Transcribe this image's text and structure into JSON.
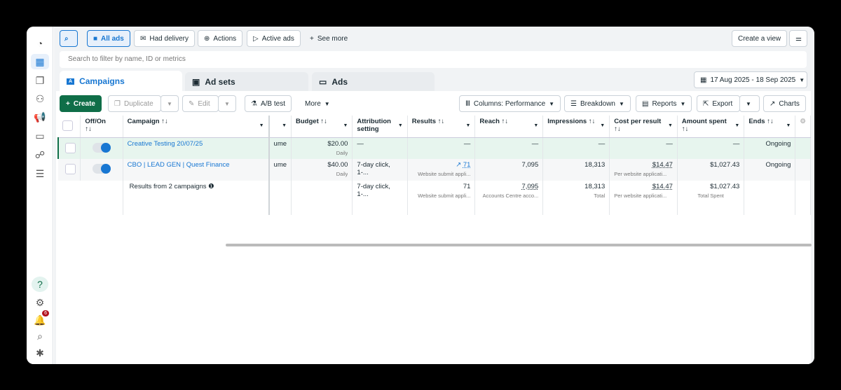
{
  "sidebar": {
    "notification_count": "6",
    "help": "?"
  },
  "filters": {
    "all_ads": "All ads",
    "had_delivery": "Had delivery",
    "actions": "Actions",
    "active_ads": "Active ads",
    "see_more": "See more",
    "create_view": "Create a view"
  },
  "search": {
    "placeholder": "Search to filter by name, ID or metrics"
  },
  "tabs": [
    {
      "label": "Campaigns"
    },
    {
      "label": "Ad sets"
    },
    {
      "label": "Ads"
    }
  ],
  "date_range": "17 Aug 2025 - 18 Sep 2025",
  "toolbar": {
    "create": "Create",
    "duplicate": "Duplicate",
    "edit": "Edit",
    "ab_test": "A/B test",
    "more": "More",
    "columns": "Columns: Performance",
    "breakdown": "Breakdown",
    "reports": "Reports",
    "export": "Export",
    "charts": "Charts"
  },
  "columns": {
    "offon": "Off/On",
    "sort": "↑↓",
    "campaign": "Campaign",
    "budget": "Budget",
    "attribution": "Attribution setting",
    "results": "Results",
    "reach": "Reach",
    "impressions": "Impressions",
    "cost": "Cost per result",
    "amount": "Amount spent",
    "ends": "Ends"
  },
  "rows": [
    {
      "name": "Creative Testing 20/07/25",
      "partial": "ume",
      "budget": "$20.00",
      "budget_type": "Daily",
      "attribution": "—",
      "results": "—",
      "reach": "—",
      "impressions": "—",
      "cost": "—",
      "amount": "—",
      "ends": "Ongoing"
    },
    {
      "name": "CBO | LEAD GEN | Quest Finance",
      "partial": "ume",
      "budget": "$40.00",
      "budget_type": "Daily",
      "attribution": "7-day click, 1-...",
      "results": "71",
      "results_sub": "Website submit appli...",
      "reach": "7,095",
      "impressions": "18,313",
      "cost": "$14.47",
      "cost_sub": "Per website applicati...",
      "amount": "$1,027.43",
      "ends": "Ongoing"
    }
  ],
  "summary": {
    "label": "Results from 2 campaigns",
    "attribution": "7-day click, 1-...",
    "results": "71",
    "results_sub": "Website submit appli...",
    "reach": "7,095",
    "reach_sub": "Accounts Centre acco...",
    "impressions": "18,313",
    "impressions_sub": "Total",
    "cost": "$14.47",
    "cost_sub": "Per website applicati...",
    "amount": "$1,027.43",
    "amount_sub": "Total Spent"
  }
}
